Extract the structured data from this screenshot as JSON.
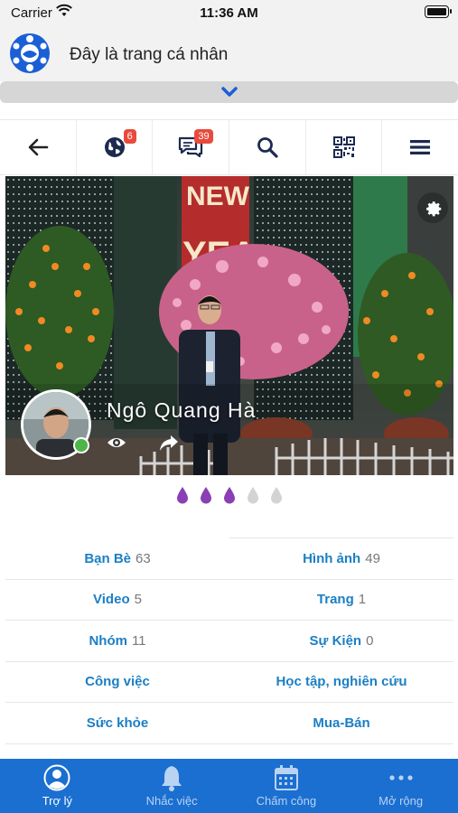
{
  "status_bar": {
    "carrier": "Carrier",
    "time": "11:36 AM"
  },
  "header": {
    "title": "Đây là trang cá nhân"
  },
  "toolbar": {
    "items": [
      {
        "icon": "back-arrow-icon"
      },
      {
        "icon": "globe-icon",
        "badge": "6"
      },
      {
        "icon": "chat-icon",
        "badge": "39"
      },
      {
        "icon": "search-icon"
      },
      {
        "icon": "qr-code-icon"
      },
      {
        "icon": "menu-icon"
      }
    ]
  },
  "profile": {
    "name": "Ngô Quang Hà",
    "online": true,
    "drops": {
      "filled": 3,
      "total": 5,
      "filled_color": "#8a3fb5",
      "empty_color": "#d3d3d3"
    }
  },
  "stats": [
    {
      "left": {
        "label": "Bạn Bè",
        "count": "63"
      },
      "right": {
        "label": "Hình ảnh",
        "count": "49"
      }
    },
    {
      "left": {
        "label": "Video",
        "count": "5"
      },
      "right": {
        "label": "Trang",
        "count": "1"
      }
    },
    {
      "left": {
        "label": "Nhóm",
        "count": "11"
      },
      "right": {
        "label": "Sự Kiện",
        "count": "0"
      }
    },
    {
      "left": {
        "label": "Công việc",
        "count": ""
      },
      "right": {
        "label": "Học tập, nghiên cứu",
        "count": ""
      }
    },
    {
      "left": {
        "label": "Sức khỏe",
        "count": ""
      },
      "right": {
        "label": "Mua-Bán",
        "count": ""
      }
    }
  ],
  "tabbar": {
    "tabs": [
      {
        "label": "Trợ lý",
        "icon": "user-icon",
        "active": true
      },
      {
        "label": "Nhắc việc",
        "icon": "bell-icon",
        "active": false
      },
      {
        "label": "Chấm công",
        "icon": "calendar-icon",
        "active": false
      },
      {
        "label": "Mở rộng",
        "icon": "more-icon",
        "active": false
      }
    ]
  },
  "colors": {
    "accent": "#1a6fd0",
    "link": "#1b7fc4",
    "badge": "#e84b3c",
    "online": "#4cb648"
  }
}
